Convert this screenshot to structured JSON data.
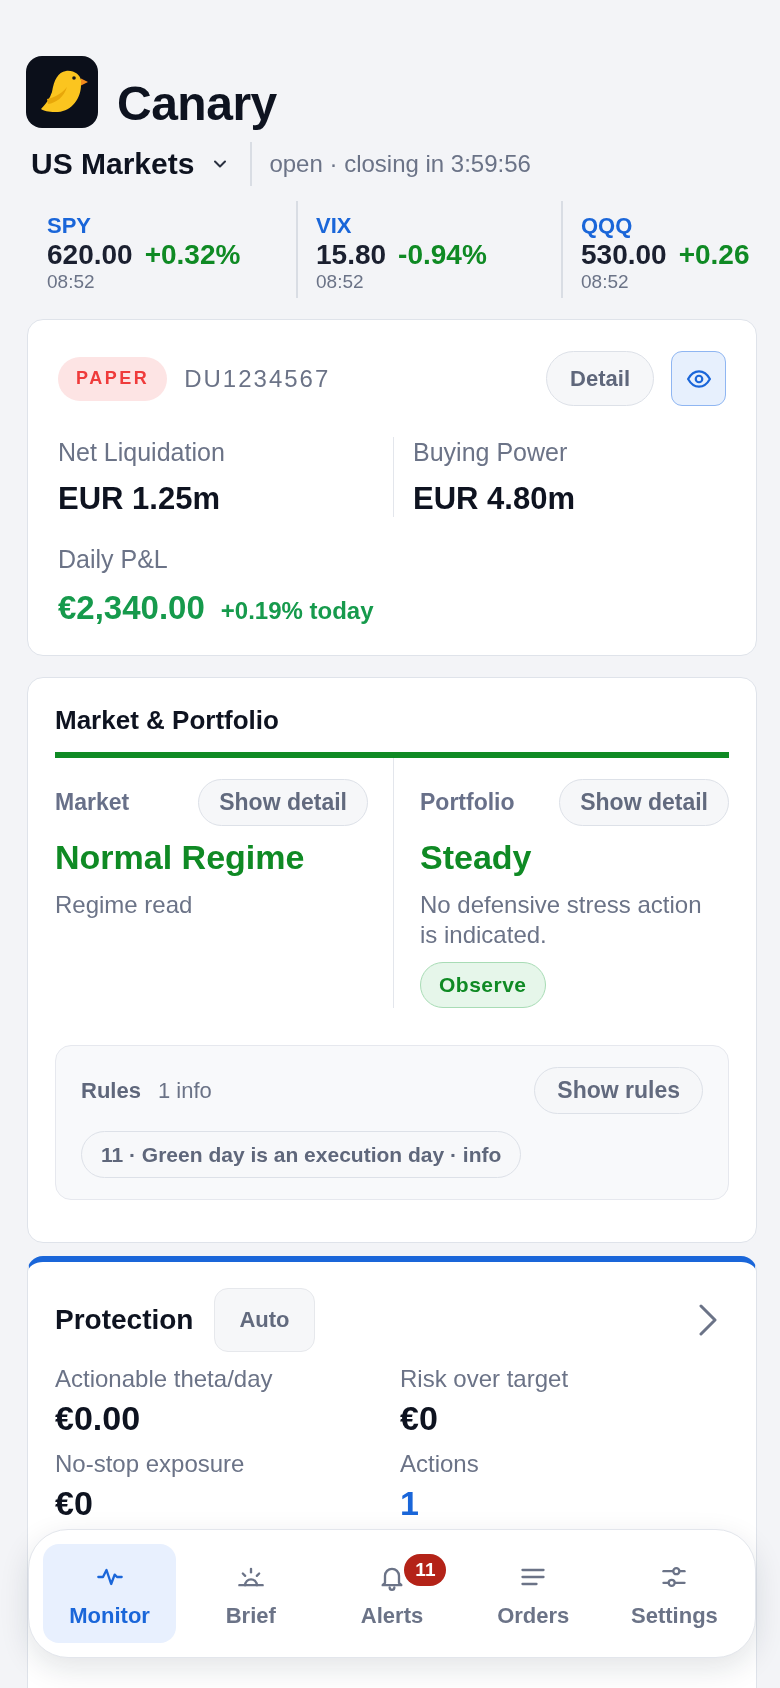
{
  "app": {
    "name": "Canary"
  },
  "market": {
    "name": "US Markets",
    "status": "open · closing in 3:59:56"
  },
  "tickers": [
    {
      "symbol": "SPY",
      "price": "620.00",
      "change": "+0.32%",
      "time": "08:52"
    },
    {
      "symbol": "VIX",
      "price": "15.80",
      "change": "-0.94%",
      "time": "08:52"
    },
    {
      "symbol": "QQQ",
      "price": "530.00",
      "change": "+0.26",
      "time": "08:52"
    }
  ],
  "account": {
    "mode": "PAPER",
    "id": "DU1234567",
    "detail_button": "Detail",
    "privacy_toggle": {
      "on": true
    },
    "metrics": [
      {
        "label": "Net Liquidation",
        "value": "EUR 1.25m"
      },
      {
        "label": "Buying Power",
        "value": "EUR 4.80m"
      }
    ],
    "daily_pnl": {
      "label": "Daily P&L",
      "value": "€2,340.00",
      "change": "+0.19% today"
    }
  },
  "market_portfolio": {
    "title": "Market & Portfolio",
    "panels": [
      {
        "label": "Market",
        "button": "Show detail",
        "status": "Normal Regime",
        "healthy": true,
        "description": "Regime read"
      },
      {
        "label": "Portfolio",
        "button": "Show detail",
        "status": "Steady",
        "healthy": true,
        "description": "No defensive stress action is indicated.",
        "badge": "Observe"
      }
    ],
    "rules": {
      "title": "Rules",
      "count": "1 info",
      "button": "Show rules",
      "items": [
        "11 · Green day is an execution day · info"
      ]
    }
  },
  "protection": {
    "title": "Protection",
    "mode": "Auto",
    "metrics": [
      {
        "label": "Actionable theta/day",
        "value": "€0.00",
        "kind": "amount"
      },
      {
        "label": "Risk over target",
        "value": "€0",
        "kind": "amount"
      },
      {
        "label": "No-stop exposure",
        "value": "€0",
        "kind": "amount"
      },
      {
        "label": "Actions",
        "value": "1",
        "kind": "count"
      }
    ]
  },
  "nav": [
    {
      "label": "Monitor",
      "selected": true
    },
    {
      "label": "Brief",
      "selected": false
    },
    {
      "label": "Alerts",
      "selected": false,
      "badge": "11"
    },
    {
      "label": "Orders",
      "selected": false
    },
    {
      "label": "Settings",
      "selected": false
    }
  ]
}
